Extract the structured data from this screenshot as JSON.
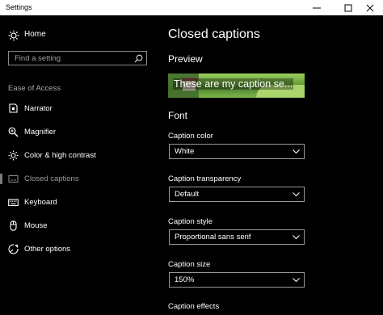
{
  "window": {
    "title": "Settings",
    "controls": {
      "minimize": "minimize-icon",
      "maximize": "maximize-icon",
      "close": "close-icon"
    }
  },
  "sidebar": {
    "home_label": "Home",
    "search_placeholder": "Find a setting",
    "section_label": "Ease of Access",
    "items": [
      {
        "label": "Narrator",
        "icon": "narrator-icon"
      },
      {
        "label": "Magnifier",
        "icon": "magnifier-icon"
      },
      {
        "label": "Color & high contrast",
        "icon": "brightness-icon"
      },
      {
        "label": "Closed captions",
        "icon": "captions-icon",
        "active": true
      },
      {
        "label": "Keyboard",
        "icon": "keyboard-icon"
      },
      {
        "label": "Mouse",
        "icon": "mouse-icon"
      },
      {
        "label": "Other options",
        "icon": "other-options-icon"
      }
    ]
  },
  "main": {
    "title": "Closed captions",
    "preview_heading": "Preview",
    "preview_caption": "These are my caption se...",
    "font_heading": "Font",
    "fields": [
      {
        "label": "Caption color",
        "value": "White"
      },
      {
        "label": "Caption transparency",
        "value": "Default"
      },
      {
        "label": "Caption style",
        "value": "Proportional sans serif"
      },
      {
        "label": "Caption size",
        "value": "150%"
      },
      {
        "label": "Caption effects",
        "value": ""
      }
    ]
  },
  "colors": {
    "background": "#000000",
    "titlebar": "#ffffff",
    "muted_text": "#a8a8a8",
    "border": "#9a9a9a"
  }
}
